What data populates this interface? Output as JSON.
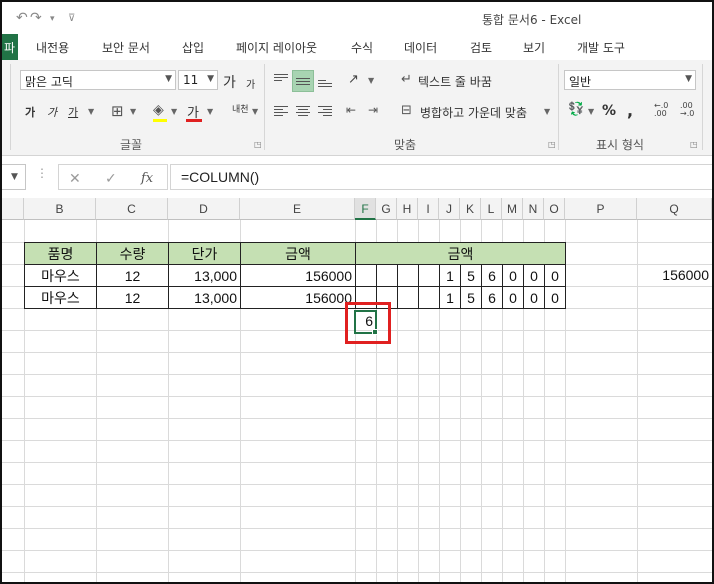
{
  "window": {
    "title": "통합 문서6 - Excel"
  },
  "quick_access": {
    "redo_icon": "redo-icon",
    "customize_icon": "customize-icon"
  },
  "tabs": [
    {
      "label": "내전용"
    },
    {
      "label": "보안 문서"
    },
    {
      "label": "삽입"
    },
    {
      "label": "페이지 레이아웃"
    },
    {
      "label": "수식"
    },
    {
      "label": "데이터"
    },
    {
      "label": "검토"
    },
    {
      "label": "보기"
    },
    {
      "label": "개발 도구"
    }
  ],
  "ribbon": {
    "font_name": "맑은 고딕",
    "font_size": "11",
    "grow_font": "가",
    "shrink_font": "가",
    "bold": "가",
    "italic": "가",
    "underline": "가",
    "font_color": "가",
    "phonetic": "내천",
    "wrap_text": "텍스트 줄 바꿈",
    "merge_center": "병합하고 가운데 맞춤",
    "number_format": "일반",
    "percent": "%",
    "comma": ",",
    "group_font": "글꼴",
    "group_align": "맞춤",
    "group_number": "표시 형식",
    "accent_color": "#217346"
  },
  "formula_bar": {
    "formula": "=COLUMN()",
    "fx_label": "fx",
    "cancel": "✕",
    "enter": "✓"
  },
  "columns": [
    "B",
    "C",
    "D",
    "E",
    "F",
    "G",
    "H",
    "I",
    "J",
    "K",
    "L",
    "M",
    "N",
    "O",
    "P",
    "Q"
  ],
  "active_column": "F",
  "table": {
    "headers": [
      "품명",
      "수량",
      "단가",
      "금액",
      "금액"
    ],
    "rows": [
      {
        "name": "마우스",
        "qty": "12",
        "price": "13,000",
        "amount": "156000",
        "digits": [
          "1",
          "5",
          "6",
          "0",
          "0",
          "0"
        ]
      },
      {
        "name": "마우스",
        "qty": "12",
        "price": "13,000",
        "amount": "156000",
        "digits": [
          "1",
          "5",
          "6",
          "0",
          "0",
          "0"
        ]
      }
    ],
    "q_value": "156000",
    "selected_value": "6",
    "header_fill": "#c5e0b3",
    "highlight_color": "#e02020"
  }
}
